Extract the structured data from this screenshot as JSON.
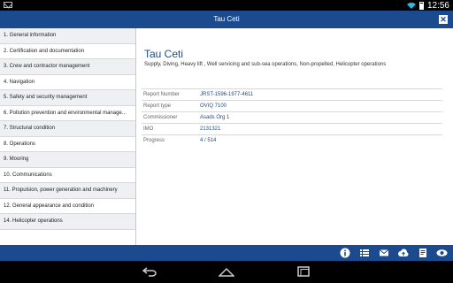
{
  "status_bar": {
    "time": "12:56"
  },
  "title_bar": {
    "title": "Tau Ceti",
    "close_icon": "close-icon"
  },
  "sidebar": {
    "items": [
      {
        "label": "1. General information"
      },
      {
        "label": "2. Certification and documentation"
      },
      {
        "label": "3. Crew and contractor management"
      },
      {
        "label": "4. Navigation"
      },
      {
        "label": "5. Safety and security management"
      },
      {
        "label": "6. Pollution prevention and environmental manage..."
      },
      {
        "label": "7. Structural condition"
      },
      {
        "label": "8. Operations"
      },
      {
        "label": "9. Mooring"
      },
      {
        "label": "10. Communications"
      },
      {
        "label": "11. Propulsion, power generation and machinery"
      },
      {
        "label": "12. General appearance and condition"
      },
      {
        "label": "14. Helicopter operations"
      }
    ]
  },
  "main": {
    "title": "Tau Ceti",
    "subtitle": "Supply, Diving, Heavy lift , Well servicing and sub-sea operations, Non-propelled, Helicopter operations",
    "details": [
      {
        "label": "Report Number",
        "value": "JRST-1596-1977-4611"
      },
      {
        "label": "Report type",
        "value": "OVIQ 7100"
      },
      {
        "label": "Commissioner",
        "value": "Asads Org 1"
      },
      {
        "label": "IMO",
        "value": "2131321"
      },
      {
        "label": "Progress",
        "value": "4 / 514"
      }
    ]
  },
  "bottom_toolbar": {
    "icons": [
      "info-icon",
      "list-icon",
      "mail-icon",
      "cloud-upload-icon",
      "document-icon",
      "eye-icon"
    ]
  },
  "nav_bar": {
    "icons": [
      "back-icon",
      "home-icon",
      "recent-apps-icon"
    ]
  },
  "colors": {
    "brand": "#1b4a8f",
    "accent": "#33b5e5"
  }
}
